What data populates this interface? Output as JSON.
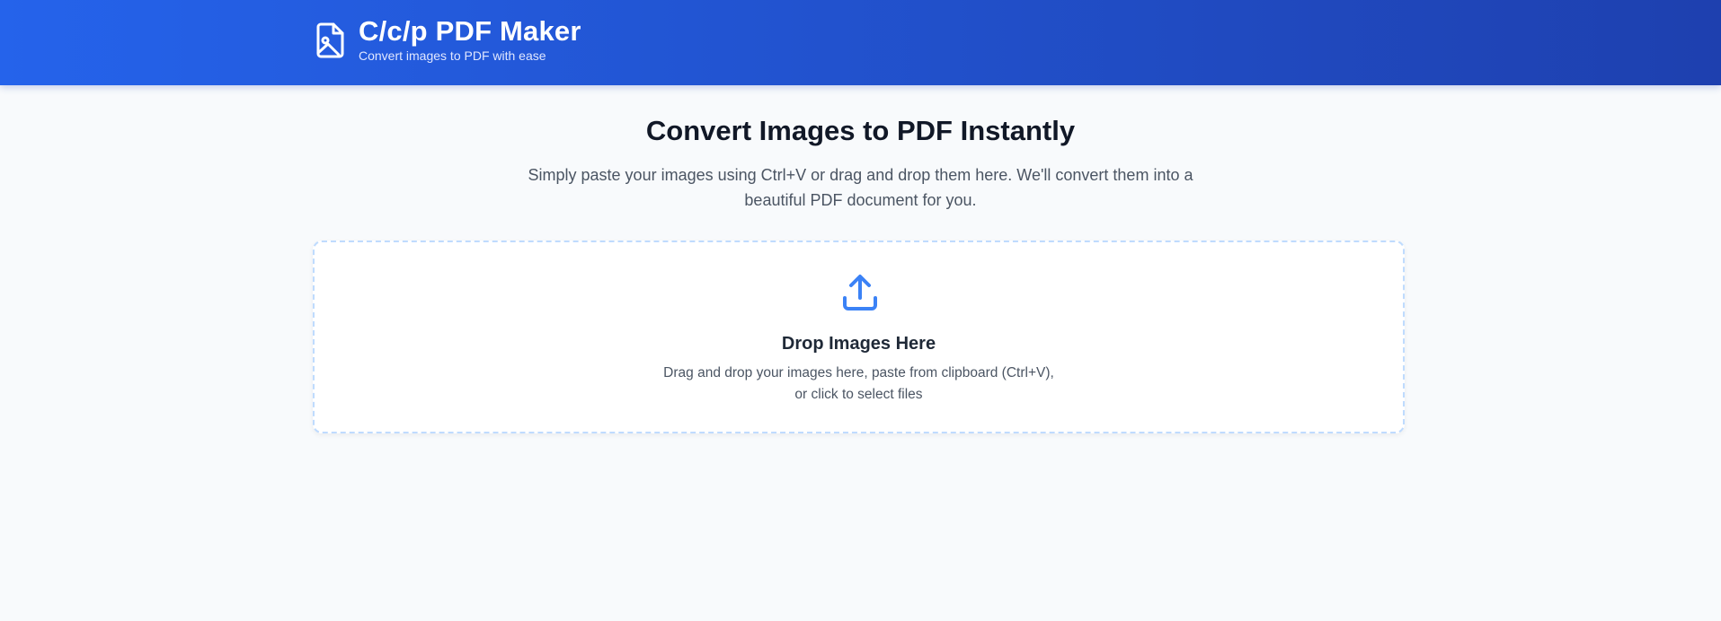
{
  "header": {
    "icon": "file-image-icon",
    "title": "C/c/p PDF Maker",
    "subtitle": "Convert images to PDF with ease"
  },
  "hero": {
    "title": "Convert Images to PDF Instantly",
    "description": "Simply paste your images using Ctrl+V or drag and drop them here. We'll convert them into a beautiful PDF document for you."
  },
  "dropzone": {
    "icon": "upload-icon",
    "title": "Drop Images Here",
    "description_line1": "Drag and drop your images here, paste from clipboard (Ctrl+V),",
    "description_line2": "or click to select files"
  },
  "colors": {
    "header_gradient_start": "#2563eb",
    "header_gradient_end": "#1e40af",
    "accent": "#3b82f6",
    "page_background": "#f8fafc"
  }
}
